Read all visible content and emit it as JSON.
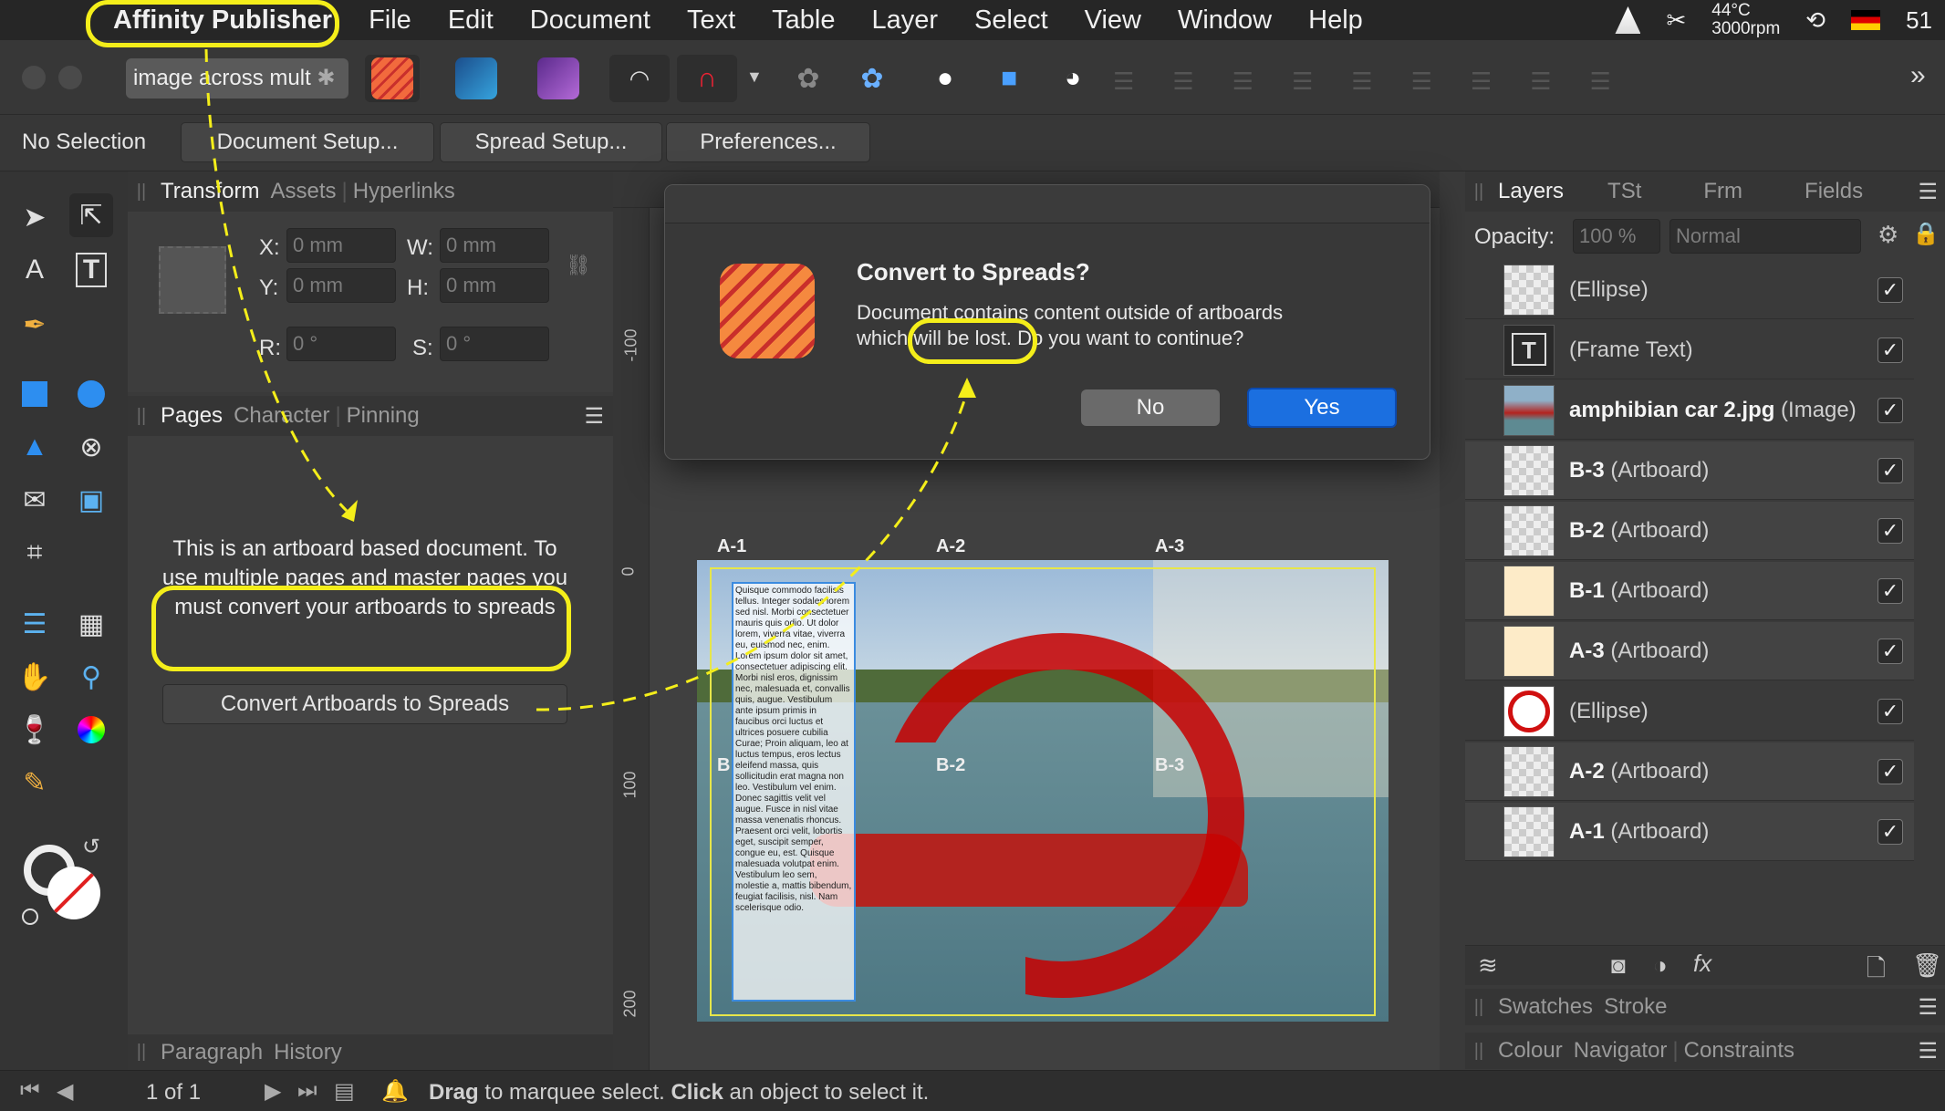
{
  "menubar": {
    "app_name": "Affinity Publisher",
    "items": [
      "File",
      "Edit",
      "Document",
      "Text",
      "Table",
      "Layer",
      "Select",
      "View",
      "Window",
      "Help"
    ],
    "sensor_temp": "44°C",
    "sensor_rpm": "3000rpm",
    "battery": "51"
  },
  "toolbar": {
    "doc_tab": "image across mult",
    "doc_tab_close": "✱"
  },
  "context": {
    "status": "No Selection",
    "document_setup": "Document Setup...",
    "spread_setup": "Spread Setup...",
    "preferences": "Preferences..."
  },
  "transform_panel": {
    "tabs": [
      "Transform",
      "Assets",
      "Hyperlinks"
    ],
    "x_label": "X:",
    "y_label": "Y:",
    "w_label": "W:",
    "h_label": "H:",
    "r_label": "R:",
    "s_label": "S:",
    "x": "0 mm",
    "y": "0 mm",
    "w": "0 mm",
    "h": "0 mm",
    "r": "0 °",
    "s": "0 °"
  },
  "pages_panel": {
    "tabs": [
      "Pages",
      "Character",
      "Pinning"
    ],
    "message": "This is an artboard based document. To use multiple pages and master pages you must convert your artboards to spreads",
    "convert_button": "Convert Artboards to Spreads"
  },
  "bottom_left_panel": {
    "tabs": [
      "Paragraph",
      "History"
    ]
  },
  "dialog": {
    "title": "Convert to Spreads?",
    "body_line1": "Document contains content outside of artboards",
    "body_line2": "which will be lost. Do you want to continue?",
    "no": "No",
    "yes": "Yes"
  },
  "canvas": {
    "ruler_unit": "mm",
    "ruler_labels": [
      "-100",
      "0",
      "100",
      "200"
    ],
    "artboards_top": [
      "A-1",
      "A-2",
      "A-3"
    ],
    "artboards_mid": [
      "B",
      "B-2",
      "B-3"
    ],
    "body_text": "Quisque commodo facilisis tellus. Integer sodales lorem sed nisl. Morbi consectetuer mauris quis odio. Ut dolor lorem, viverra vitae, viverra eu, euismod nec, enim. Lorem ipsum dolor sit amet, consectetuer adipiscing elit. Morbi nisl eros, dignissim nec, malesuada et, convallis quis, augue. Vestibulum ante ipsum primis in faucibus orci luctus et ultrices posuere cubilia Curae; Proin aliquam, leo at luctus tempus, eros lectus eleifend massa, quis sollicitudin erat magna non leo. Vestibulum vel enim. Donec sagittis velit vel augue. Fusce in nisl vitae massa venenatis rhoncus. Praesent orci velit, lobortis eget, suscipit semper, congue eu, est. Quisque malesuada volutpat enim. Vestibulum leo sem, molestie a, mattis bibendum, feugiat facilisis, nisl. Nam scelerisque odio."
  },
  "layers_panel": {
    "tabs": [
      "Layers",
      "TSt",
      "Frm",
      "Fields"
    ],
    "opacity_label": "Opacity:",
    "opacity": "100 %",
    "blend_mode": "Normal",
    "rows": [
      {
        "name": "",
        "type": "(Ellipse)",
        "thumb": "checker",
        "checked": "✓"
      },
      {
        "name": "",
        "type": "(Frame Text)",
        "thumb": "text",
        "checked": "✓"
      },
      {
        "name": "amphibian car 2.jpg",
        "type": " (Image)",
        "thumb": "photo",
        "checked": "✓"
      },
      {
        "name": "B-3",
        "type": " (Artboard)",
        "thumb": "checker",
        "checked": "✓"
      },
      {
        "name": "B-2",
        "type": " (Artboard)",
        "thumb": "checker",
        "checked": "✓"
      },
      {
        "name": "B-1",
        "type": " (Artboard)",
        "thumb": "cream",
        "checked": "✓"
      },
      {
        "name": "A-3",
        "type": " (Artboard)",
        "thumb": "cream",
        "checked": "✓"
      },
      {
        "name": "",
        "type": "(Ellipse)",
        "thumb": "ellipse",
        "checked": "✓"
      },
      {
        "name": "A-2",
        "type": " (Artboard)",
        "thumb": "checker",
        "checked": "✓"
      },
      {
        "name": "A-1",
        "type": " (Artboard)",
        "thumb": "checker",
        "checked": "✓"
      }
    ]
  },
  "right_bottom_panels": {
    "tabs1": [
      "Swatches",
      "Stroke"
    ],
    "tabs2": [
      "Colour",
      "Navigator",
      "Constraints"
    ]
  },
  "statusbar": {
    "page": "1 of 1",
    "hint_bold1": "Drag",
    "hint_mid": " to marquee select. ",
    "hint_bold2": "Click",
    "hint_end": " an object to select it."
  },
  "colors": {
    "accent": "#1b6fe0",
    "annotation": "#f4ee1a",
    "publisher_orange": "#f07a3a"
  }
}
